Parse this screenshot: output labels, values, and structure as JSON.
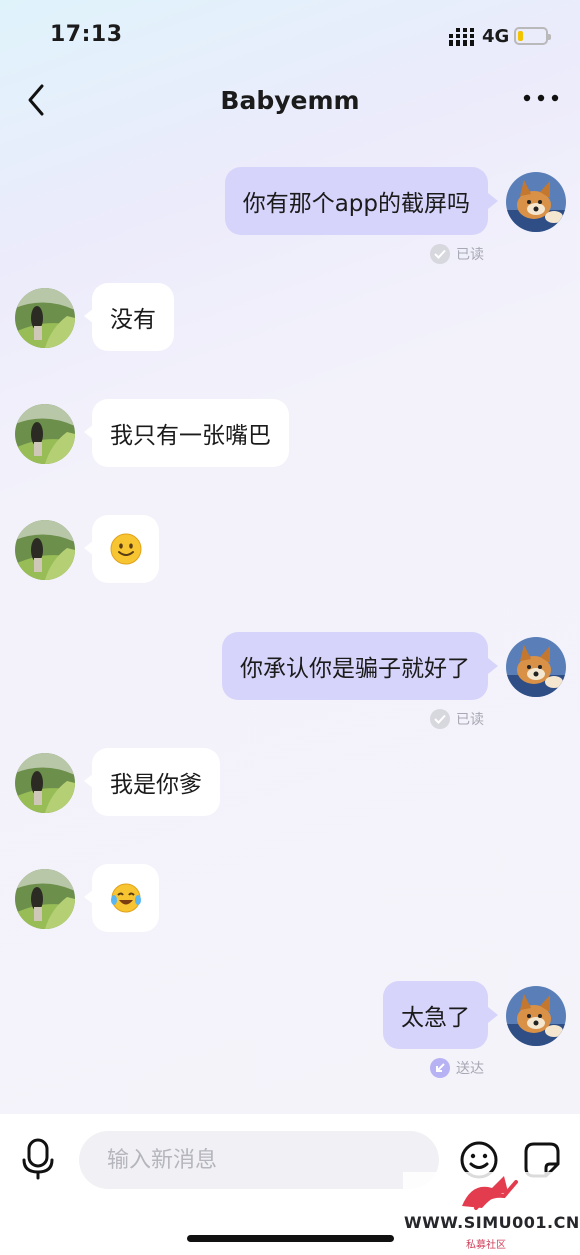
{
  "status_bar": {
    "time": "17:13",
    "network": "4G",
    "battery_level": 0.15
  },
  "header": {
    "title": "Babyemm"
  },
  "messages": [
    {
      "dir": "out",
      "text": "你有那个app的截屏吗",
      "status": "已读",
      "status_icon": "check-icon"
    },
    {
      "dir": "in",
      "text": "没有"
    },
    {
      "dir": "in",
      "text": "我只有一张嘴巴"
    },
    {
      "dir": "in",
      "text": "🙂"
    },
    {
      "dir": "out",
      "text": "你承认你是骗子就好了",
      "status": "已读",
      "status_icon": "check-icon"
    },
    {
      "dir": "in",
      "text": "我是你爹"
    },
    {
      "dir": "in",
      "text": "😂"
    },
    {
      "dir": "out",
      "text": "太急了",
      "status": "送达",
      "status_icon": "send-arrow-icon"
    }
  ],
  "input": {
    "placeholder": "输入新消息"
  },
  "watermark": {
    "text": "WWW.SIMU001.CN",
    "sub": "私募社区"
  },
  "colors": {
    "outgoing_bubble": "#d7d4fb",
    "incoming_bubble": "#ffffff",
    "accent": "#b7b2f3"
  }
}
